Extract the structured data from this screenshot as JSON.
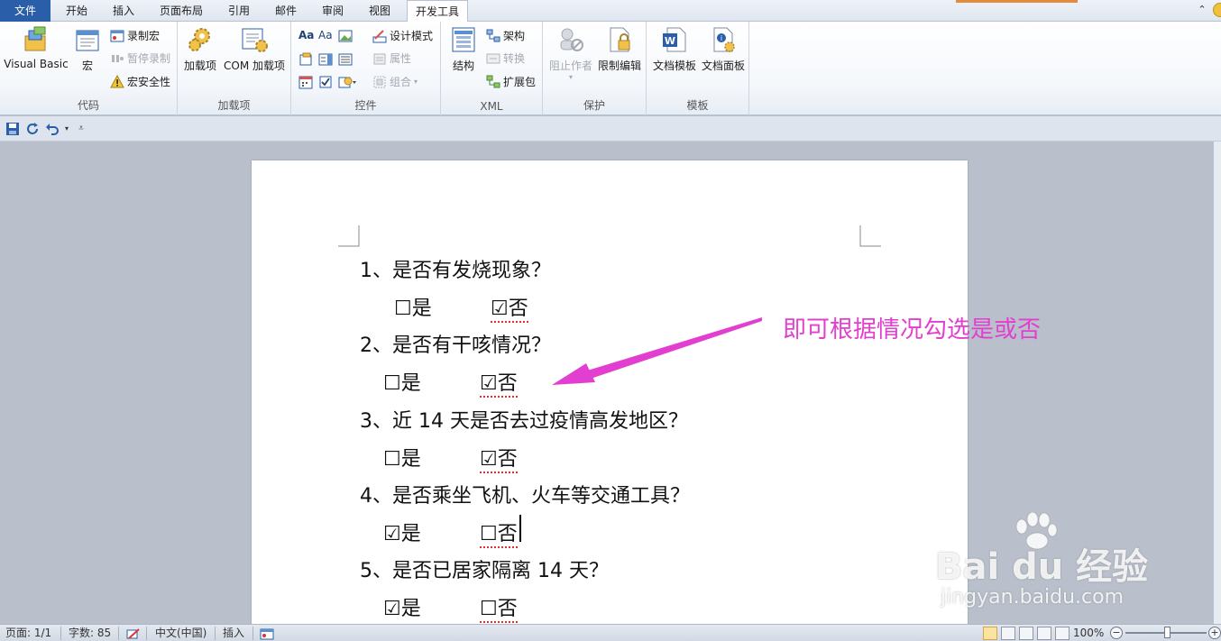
{
  "tabs": [
    {
      "label": "文件"
    },
    {
      "label": "开始"
    },
    {
      "label": "插入"
    },
    {
      "label": "页面布局"
    },
    {
      "label": "引用"
    },
    {
      "label": "邮件"
    },
    {
      "label": "审阅"
    },
    {
      "label": "视图"
    },
    {
      "label": "开发工具"
    }
  ],
  "ribbon": {
    "code": {
      "label": "代码",
      "visual_basic": "Visual Basic",
      "macro": "宏",
      "record_macro": "录制宏",
      "pause_recording": "暂停录制",
      "macro_security": "宏安全性"
    },
    "addins": {
      "label": "加载项",
      "addins": "加载项",
      "com_addins": "COM 加载项"
    },
    "controls": {
      "label": "控件",
      "design_mode": "设计模式",
      "properties": "属性",
      "group": "组合"
    },
    "xml": {
      "label": "XML",
      "structure": "结构",
      "schema": "架构",
      "transform": "转换",
      "expansion_pack": "扩展包"
    },
    "protect": {
      "label": "保护",
      "block_authors": "阻止作者",
      "restrict_editing": "限制编辑"
    },
    "templates": {
      "label": "模板",
      "document_template": "文档模板",
      "document_panel": "文档面板"
    }
  },
  "document": {
    "questions": [
      {
        "text": "1、是否有发烧现象？",
        "yes": "☐是",
        "no": "☑否"
      },
      {
        "text": "2、是否有干咳情况？",
        "yes": "☐是",
        "no": "☑否"
      },
      {
        "text": "3、近 14 天是否去过疫情高发地区？",
        "yes": "☐是",
        "no": "☑否"
      },
      {
        "text": "4、是否乘坐飞机、火车等交通工具？",
        "yes": "☑是",
        "no": "☐否"
      },
      {
        "text": "5、是否已居家隔离 14 天？",
        "yes": "☑是",
        "no": "☐否"
      }
    ]
  },
  "annotation": "即可根据情况勾选是或否",
  "watermark": {
    "brand": "Bai du 经验",
    "url": "jingyan.baidu.com"
  },
  "status": {
    "page": "页面: 1/1",
    "words": "字数: 85",
    "language": "中文(中国)",
    "mode": "插入",
    "zoom": "100%"
  },
  "colors": {
    "annotation": "#e23ecf",
    "file_tab": "#2a5ea8"
  }
}
